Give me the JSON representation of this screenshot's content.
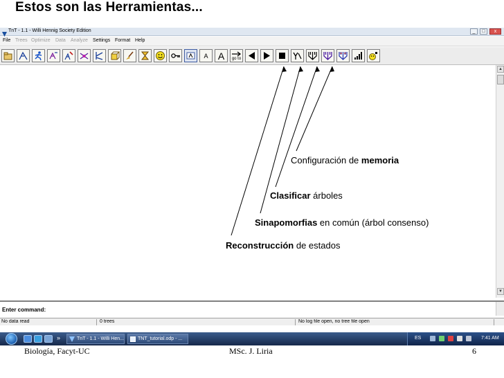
{
  "slide": {
    "title": "Estos son las Herramientas...",
    "footer_left": "Biología, Facyt-UC",
    "footer_center": "MSc. J. Liria",
    "page_number": "6"
  },
  "window": {
    "title": "TnT - 1.1 - Willi Hennig Society Edition",
    "minimize": "_",
    "maximize": "□",
    "close": "x"
  },
  "menu": {
    "items": [
      {
        "label": "File",
        "enabled": true
      },
      {
        "label": "Trees",
        "enabled": false
      },
      {
        "label": "Optimize",
        "enabled": false
      },
      {
        "label": "Data",
        "enabled": false
      },
      {
        "label": "Analyze",
        "enabled": false
      },
      {
        "label": "Settings",
        "enabled": true
      },
      {
        "label": "Format",
        "enabled": true
      },
      {
        "label": "Help",
        "enabled": true
      }
    ]
  },
  "toolbar": {
    "buttons": [
      {
        "icon": "open-file-icon",
        "glyph": ""
      },
      {
        "icon": "tree-view-icon",
        "glyph": ""
      },
      {
        "icon": "runner-icon",
        "glyph": ""
      },
      {
        "icon": "search-tree-icon",
        "glyph": ""
      },
      {
        "icon": "edit-tree-icon",
        "glyph": ""
      },
      {
        "icon": "swap-icon",
        "glyph": ""
      },
      {
        "icon": "branch-icon",
        "glyph": ""
      },
      {
        "icon": "cube-icon",
        "glyph": ""
      },
      {
        "icon": "broom-icon",
        "glyph": ""
      },
      {
        "icon": "hourglass-icon",
        "glyph": ""
      },
      {
        "icon": "smiley-icon",
        "glyph": ""
      },
      {
        "icon": "key-icon",
        "glyph": ""
      },
      {
        "icon": "font-small-icon",
        "glyph": ""
      },
      {
        "icon": "font-a-icon",
        "glyph": "A"
      },
      {
        "icon": "font-large-a-icon",
        "glyph": "A"
      },
      {
        "icon": "goto-icon",
        "glyph": "go to"
      },
      {
        "icon": "arrow-left-icon",
        "glyph": ""
      },
      {
        "icon": "arrow-right-icon",
        "glyph": ""
      },
      {
        "icon": "stop-icon",
        "glyph": ""
      },
      {
        "icon": "tree-y-icon",
        "glyph": ""
      },
      {
        "icon": "character-mapping-icon",
        "glyph": ""
      },
      {
        "icon": "synapomorphies-icon",
        "glyph": ""
      },
      {
        "icon": "sort-trees-icon",
        "glyph": ""
      },
      {
        "icon": "memory-bars-icon",
        "glyph": ""
      },
      {
        "icon": "memory-config-icon",
        "glyph": ""
      }
    ]
  },
  "command": {
    "label": "Enter command:"
  },
  "status": {
    "data": "No data read",
    "trees": "0 trees",
    "log": "No log file open, no tree file open"
  },
  "taskbar": {
    "tasks": [
      {
        "label": "TnT - 1.1 - Willi Hen..."
      },
      {
        "label": "TNT_tutorial.odp - ..."
      }
    ],
    "language": "ES",
    "clock": "7:41 AM",
    "overflow": "»"
  },
  "annotations": {
    "memory": {
      "prefix": "Configuración de ",
      "bold": "memoria",
      "suffix": ""
    },
    "sort": {
      "prefix": "",
      "bold": "Clasificar",
      "suffix": " árboles"
    },
    "synapomorphies": {
      "prefix": "",
      "bold": "Sinapomorfias",
      "suffix": " en común (árbol consenso)"
    },
    "reconstruction": {
      "prefix": "",
      "bold": "Reconstrucción",
      "suffix": " de estados"
    }
  }
}
